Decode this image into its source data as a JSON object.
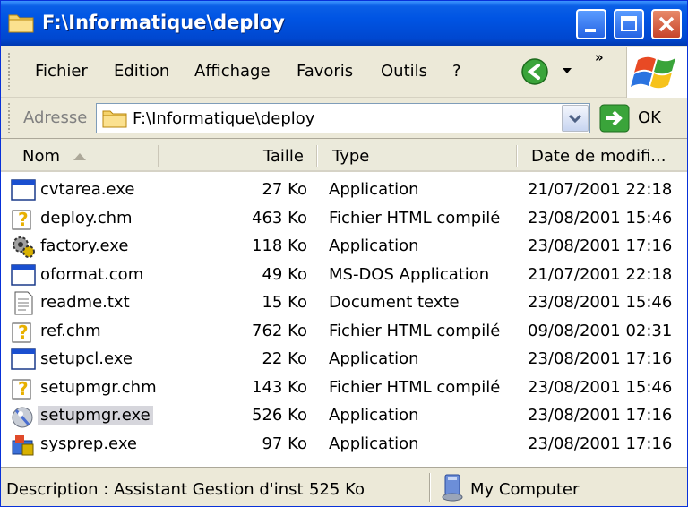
{
  "window": {
    "title": "F:\\Informatique\\deploy"
  },
  "menu": [
    "Fichier",
    "Edition",
    "Affichage",
    "Favoris",
    "Outils",
    "?"
  ],
  "address": {
    "label": "Adresse",
    "value": "F:\\Informatique\\deploy",
    "go_label": "OK"
  },
  "columns": {
    "name": "Nom",
    "size": "Taille",
    "type": "Type",
    "date": "Date de modifi..."
  },
  "files": [
    {
      "icon": "application-icon",
      "name": "cvtarea.exe",
      "size": "27 Ko",
      "type": "Application",
      "date": "21/07/2001 22:18"
    },
    {
      "icon": "help-file-icon",
      "name": "deploy.chm",
      "size": "463 Ko",
      "type": "Fichier HTML compilé",
      "date": "23/08/2001 15:46"
    },
    {
      "icon": "gears-icon",
      "name": "factory.exe",
      "size": "118 Ko",
      "type": "Application",
      "date": "23/08/2001 17:16"
    },
    {
      "icon": "application-icon",
      "name": "oformat.com",
      "size": "49 Ko",
      "type": "MS-DOS Application",
      "date": "21/07/2001 22:18"
    },
    {
      "icon": "text-document-icon",
      "name": "readme.txt",
      "size": "15 Ko",
      "type": "Document texte",
      "date": "23/08/2001 15:46"
    },
    {
      "icon": "help-file-icon",
      "name": "ref.chm",
      "size": "762 Ko",
      "type": "Fichier HTML compilé",
      "date": "09/08/2001 02:31"
    },
    {
      "icon": "application-icon",
      "name": "setupcl.exe",
      "size": "22 Ko",
      "type": "Application",
      "date": "23/08/2001 17:16"
    },
    {
      "icon": "help-file-icon",
      "name": "setupmgr.chm",
      "size": "143 Ko",
      "type": "Fichier HTML compilé",
      "date": "23/08/2001 15:46"
    },
    {
      "icon": "setup-wizard-icon",
      "name": "setupmgr.exe",
      "size": "526 Ko",
      "type": "Application",
      "date": "23/08/2001 17:16",
      "selected": true
    },
    {
      "icon": "sysprep-icon",
      "name": "sysprep.exe",
      "size": "97 Ko",
      "type": "Application",
      "date": "23/08/2001 17:16"
    }
  ],
  "status": {
    "description": "Description : Assistant Gestion d'inst",
    "size": "525 Ko",
    "location": "My Computer"
  },
  "colors": {
    "titlebar": "#0054e3",
    "chrome": "#ece9d8",
    "selection": "#d6d6dc",
    "go_green": "#3aa43a"
  }
}
